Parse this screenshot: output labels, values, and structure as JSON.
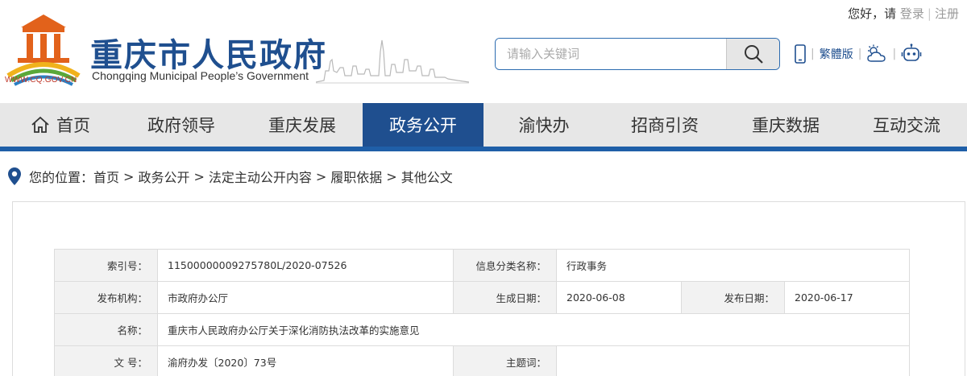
{
  "header": {
    "greeting": "您好，请",
    "login": "登录",
    "register": "注册",
    "logo_url": "WWW.CQ.GOV.CN",
    "title": "重庆市人民政府",
    "subtitle": "Chongqing Municipal People’s Government",
    "search_placeholder": "请输入关键词",
    "traditional": "繁體版"
  },
  "nav": {
    "items": [
      {
        "label": "首页",
        "active": false
      },
      {
        "label": "政府领导",
        "active": false
      },
      {
        "label": "重庆发展",
        "active": false
      },
      {
        "label": "政务公开",
        "active": true
      },
      {
        "label": "渝快办",
        "active": false
      },
      {
        "label": "招商引资",
        "active": false
      },
      {
        "label": "重庆数据",
        "active": false
      },
      {
        "label": "互动交流",
        "active": false
      }
    ]
  },
  "breadcrumb": {
    "prefix": "您的位置：",
    "items": [
      "首页",
      "政务公开",
      "法定主动公开内容",
      "履职依据",
      "其他公文"
    ]
  },
  "info": {
    "index_label": "索引号：",
    "index_value": "11500000009275780L/2020-07526",
    "category_label": "信息分类名称：",
    "category_value": "行政事务",
    "org_label": "发布机构：",
    "org_value": "市政府办公厅",
    "created_label": "生成日期：",
    "created_value": "2020-06-08",
    "published_label": "发布日期：",
    "published_value": "2020-06-17",
    "name_label": "名称：",
    "name_value": "重庆市人民政府办公厅关于深化消防执法改革的实施意见",
    "docno_label": "文 号：",
    "docno_value": "渝府办发〔2020〕73号",
    "subject_label": "主题词：",
    "subject_value": ""
  },
  "colors": {
    "brand_blue": "#1f4f8f",
    "nav_bg": "#e7e7e7",
    "accent_line": "#1f5fa8"
  }
}
